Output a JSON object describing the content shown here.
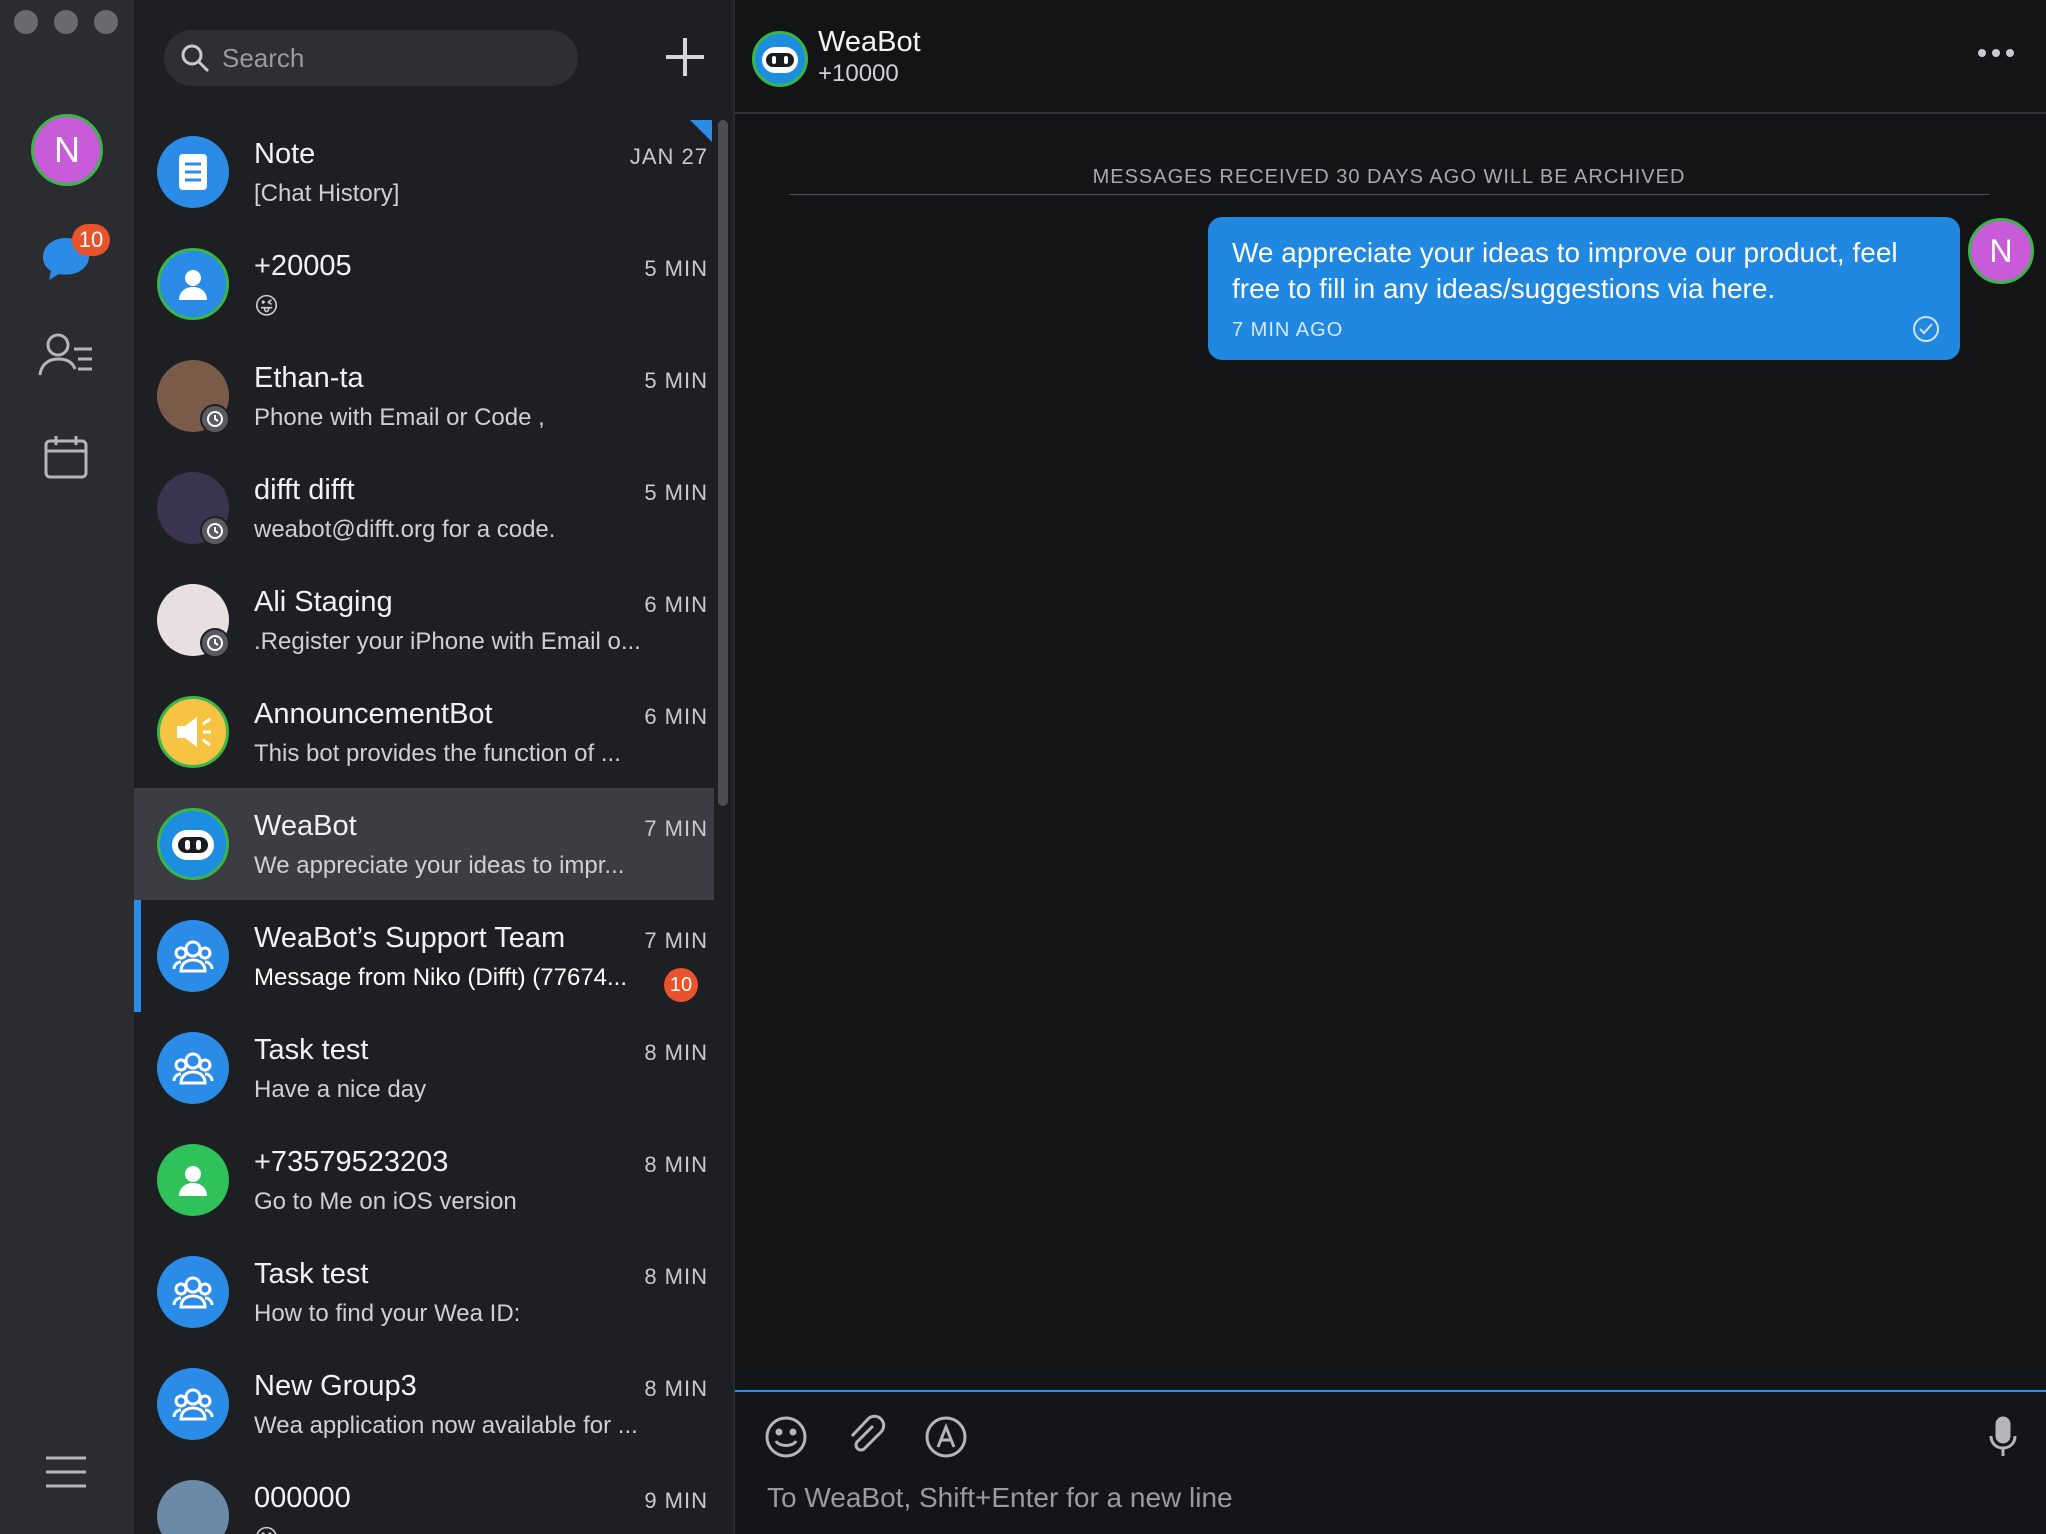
{
  "rail": {
    "avatar_letter": "N",
    "unread_badge": "10",
    "icons": [
      "chat-icon",
      "contacts-icon",
      "calendar-icon",
      "menu-icon"
    ]
  },
  "search": {
    "placeholder": "Search"
  },
  "conversations": [
    {
      "name": "Note",
      "time": "JAN 27",
      "preview": "[Chat History]",
      "avatar": "note",
      "color": "#2b8ce8"
    },
    {
      "name": "+20005",
      "time": "5 MIN",
      "preview": "😜",
      "avatar": "person",
      "color": "#2b8ce8"
    },
    {
      "name": "Ethan-ta",
      "time": "5 MIN",
      "preview": "Phone with Email or Code ,",
      "avatar": "photo"
    },
    {
      "name": "difft difft",
      "time": "5 MIN",
      "preview": "weabot@difft.org for a code.",
      "avatar": "photo"
    },
    {
      "name": "Ali Staging",
      "time": "6 MIN",
      "preview": ".Register your iPhone with Email o...",
      "avatar": "photo"
    },
    {
      "name": "AnnouncementBot",
      "time": "6 MIN",
      "preview": "This bot provides the function of ...",
      "avatar": "announce",
      "color": "#f6c343"
    },
    {
      "name": "WeaBot",
      "time": "7 MIN",
      "preview": "We appreciate your ideas to impr...",
      "avatar": "bot",
      "color": "#1d8de0"
    },
    {
      "name": "WeaBot’s Support Team",
      "time": "7 MIN",
      "preview": "Message from Niko (Difft) (77674...",
      "avatar": "group",
      "color": "#2b8ce8",
      "unread": "10"
    },
    {
      "name": "Task test",
      "time": "8 MIN",
      "preview": "Have a nice day",
      "avatar": "group",
      "color": "#2b8ce8"
    },
    {
      "name": "+73579523203",
      "time": "8 MIN",
      "preview": "Go to Me on iOS version",
      "avatar": "person",
      "color": "#2fc25b"
    },
    {
      "name": "Task test",
      "time": "8 MIN",
      "preview": "How to find your Wea ID:",
      "avatar": "group",
      "color": "#2b8ce8"
    },
    {
      "name": "New Group3",
      "time": "8 MIN",
      "preview": "Wea application now available for ...",
      "avatar": "group",
      "color": "#2b8ce8"
    },
    {
      "name": "000000",
      "time": "9 MIN",
      "preview": "😀",
      "avatar": "photo"
    }
  ],
  "chat": {
    "title": "WeaBot",
    "subtitle": "+10000",
    "archive_notice": "MESSAGES RECEIVED 30 DAYS AGO WILL BE ARCHIVED",
    "message": {
      "text": "We appreciate your ideas to improve our product, feel free to fill in any ideas/suggestions via here.",
      "time": "7 MIN AGO"
    },
    "me_avatar_letter": "N",
    "composer_placeholder": "To WeaBot, Shift+Enter for a new line"
  },
  "colors": {
    "accent": "#2b8ce8",
    "badge": "#e8532b",
    "online_ring": "#39b54a"
  }
}
